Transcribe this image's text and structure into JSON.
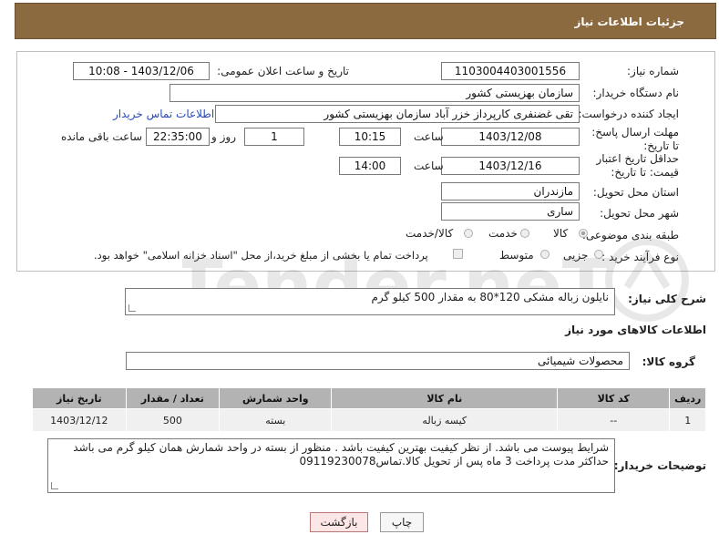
{
  "page": {
    "header_title": "جزئیات اطلاعات نیاز"
  },
  "fields": {
    "need_number_label": "شماره نیاز:",
    "need_number": "1103004403001556",
    "announce_datetime_label": "تاریخ و ساعت اعلان عمومی:",
    "announce_datetime": "1403/12/06 - 10:08",
    "buyer_org_label": "نام دستگاه خریدار:",
    "buyer_org": "سازمان بهزیستی کشور",
    "requester_label": "ایجاد کننده درخواست:",
    "requester": "تقی غضنفری کارپرداز خزر آباد سازمان بهزیستی کشور",
    "buyer_contact_link": "اطلاعات تماس خریدار",
    "reply_deadline_label": "مهلت ارسال پاسخ: تا تاریخ:",
    "reply_date": "1403/12/08",
    "time_label": "ساعت",
    "reply_time": "10:15",
    "days_value": "1",
    "days_label": "روز و",
    "remaining_time": "22:35:00",
    "remaining_label": "ساعت باقی مانده",
    "price_validity_label": "حداقل تاریخ اعتبار قیمت: تا تاریخ:",
    "validity_date": "1403/12/16",
    "validity_time": "14:00",
    "province_label": "استان محل تحویل:",
    "province": "مازندران",
    "city_label": "شهر محل تحویل:",
    "city": "ساری",
    "category_label": "طبقه بندی موضوعی:",
    "category_options": [
      "کالا",
      "خدمت",
      "کالا/خدمت"
    ],
    "category_selected": "کالا",
    "process_label": "نوع فرآیند خرید :",
    "process_options": [
      "جزیی",
      "متوسط"
    ],
    "payment_note": "پرداخت تمام یا بخشی از مبلغ خرید،از محل \"اسناد خزانه اسلامی\" خواهد بود."
  },
  "description": {
    "label": "شرح کلی نیاز:",
    "text": "نایلون زباله مشکی 120*80 به مقدار 500 کیلو گرم"
  },
  "goods": {
    "section_title": "اطلاعات کالاهای مورد نیاز",
    "group_label": "گروه کالا:",
    "group_value": "محصولات شیمیائی",
    "columns": [
      "ردیف",
      "کد کالا",
      "نام کالا",
      "واحد شمارش",
      "تعداد / مقدار",
      "تاریخ نیاز"
    ],
    "rows": [
      [
        "1",
        "--",
        "کیسه زباله",
        "بسته",
        "500",
        "1403/12/12"
      ]
    ]
  },
  "buyer_notes": {
    "label": "توضیحات خریدار:",
    "text": "شرایط پیوست می باشد. از نظر کیفیت بهترین کیفیت باشد . منظور از بسته در واحد شمارش همان کیلو گرم می باشد حداکثر مدت پرداخت 3 ماه پس از تحویل کالا.تماس09119230078"
  },
  "buttons": {
    "print": "چاپ",
    "back": "بازگشت"
  },
  "watermark_text": "AriaTender.neT",
  "colors": {
    "header_bg": "#8c6a3f",
    "table_header_bg": "#b3b3b3",
    "link": "#2a4bb5",
    "back_button_bg": "#fde6e6"
  }
}
